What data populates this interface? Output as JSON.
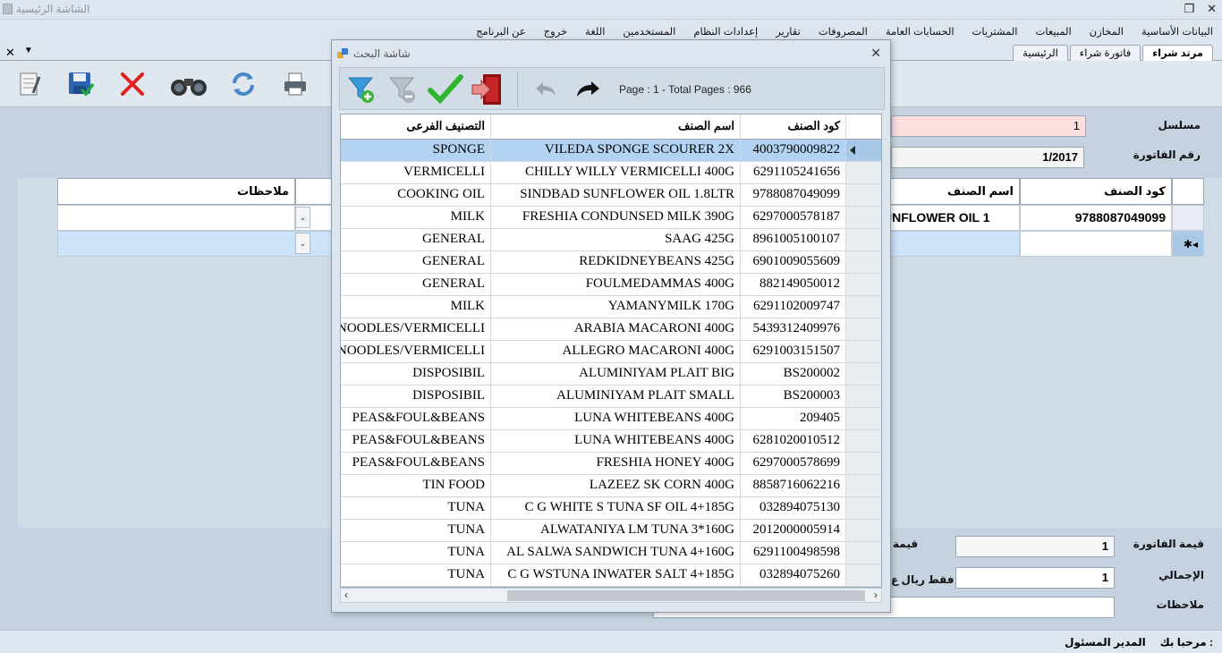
{
  "window": {
    "title": "الشاشة الرئيسية"
  },
  "menu": [
    "البيانات الأساسية",
    "المخازن",
    "المبيعات",
    "المشتريات",
    "الحسابات العامة",
    "المصروفات",
    "تقارير",
    "إعدادات النظام",
    "المستخدمين",
    "اللغة",
    "خروج",
    "عن البرنامج"
  ],
  "tabs": [
    "مرتد شراء",
    "فاتورة شراء",
    "الرئيسية"
  ],
  "toolbar_icons": [
    "notes-icon",
    "save-icon",
    "delete-icon",
    "search-binoculars-icon",
    "refresh-icon",
    "print-icon"
  ],
  "form": {
    "serial_label": "مسلسل",
    "serial_value": "1",
    "invoice_no_label": "رقم الفاتورة",
    "invoice_no_value": "1/2017",
    "grid_headers": {
      "code": "كود الصنف",
      "name": "اسم الصنف",
      "notes": "ملاحظات"
    },
    "grid_row": {
      "code": "9788087049099",
      "name": "UNFLOWER OIL 1"
    },
    "invoice_value_label": "قيمة الفاتورة",
    "invoice_value": "1",
    "total_label": "الإجمالي",
    "total_value": "1",
    "notes_label": "ملاحظات",
    "value_label_partial": "قيمة",
    "words_partial": "فقط ريال ع"
  },
  "status": {
    "welcome": "مرحبا بك :",
    "user": "المدير المسئول"
  },
  "dialog": {
    "title": "شاشة البحث",
    "page_info": "Page : 1  - Total Pages : 966",
    "columns": {
      "code": "كود الصنف",
      "name": "اسم الصنف",
      "subcategory": "التصنيف الفرعى"
    },
    "rows": [
      {
        "code": "4003790009822",
        "name": "VILEDA SPONGE SCOURER 2X",
        "sub": "SPONGE"
      },
      {
        "code": "6291105241656",
        "name": "CHILLY WILLY VERMICELLI 400G",
        "sub": "VERMICELLI"
      },
      {
        "code": "9788087049099",
        "name": "SINDBAD SUNFLOWER OIL 1.8LTR",
        "sub": "COOKING OIL"
      },
      {
        "code": "6297000578187",
        "name": "FRESHIA CONDUNSED MILK 390G",
        "sub": "MILK"
      },
      {
        "code": "8961005100107",
        "name": "SAAG 425G",
        "sub": "GENERAL"
      },
      {
        "code": "6901009055609",
        "name": "REDKIDNEYBEANS 425G",
        "sub": "GENERAL"
      },
      {
        "code": "882149050012",
        "name": "FOULMEDAMMAS 400G",
        "sub": "GENERAL"
      },
      {
        "code": "6291102009747",
        "name": "YAMANYMILK 170G",
        "sub": "MILK"
      },
      {
        "code": "5439312409976",
        "name": "ARABIA MACARONI 400G",
        "sub": "NOODLES/VERMICELLI"
      },
      {
        "code": "6291003151507",
        "name": "ALLEGRO MACARONI 400G",
        "sub": "NOODLES/VERMICELLI"
      },
      {
        "code": "BS200002",
        "name": "ALUMINIYAM PLAIT BIG",
        "sub": "DISPOSIBIL"
      },
      {
        "code": "BS200003",
        "name": "ALUMINIYAM PLAIT SMALL",
        "sub": "DISPOSIBIL"
      },
      {
        "code": "209405",
        "name": "LUNA WHITEBEANS 400G",
        "sub": "PEAS&FOUL&BEANS"
      },
      {
        "code": "6281020010512",
        "name": "LUNA WHITEBEANS 400G",
        "sub": "PEAS&FOUL&BEANS"
      },
      {
        "code": "6297000578699",
        "name": "FRESHIA HONEY 400G",
        "sub": "PEAS&FOUL&BEANS"
      },
      {
        "code": "8858716062216",
        "name": "LAZEEZ SK CORN 400G",
        "sub": "TIN FOOD"
      },
      {
        "code": "032894075130",
        "name": "C G WHITE S TUNA SF OIL 4+185G",
        "sub": "TUNA"
      },
      {
        "code": "2012000005914",
        "name": "ALWATANIYA  LM TUNA 3*160G",
        "sub": "TUNA"
      },
      {
        "code": "6291100498598",
        "name": "AL SALWA SANDWICH TUNA 4+160G",
        "sub": "TUNA"
      },
      {
        "code": "032894075260",
        "name": "C G WSTUNA INWATER SALT 4+185G",
        "sub": "TUNA"
      }
    ]
  }
}
